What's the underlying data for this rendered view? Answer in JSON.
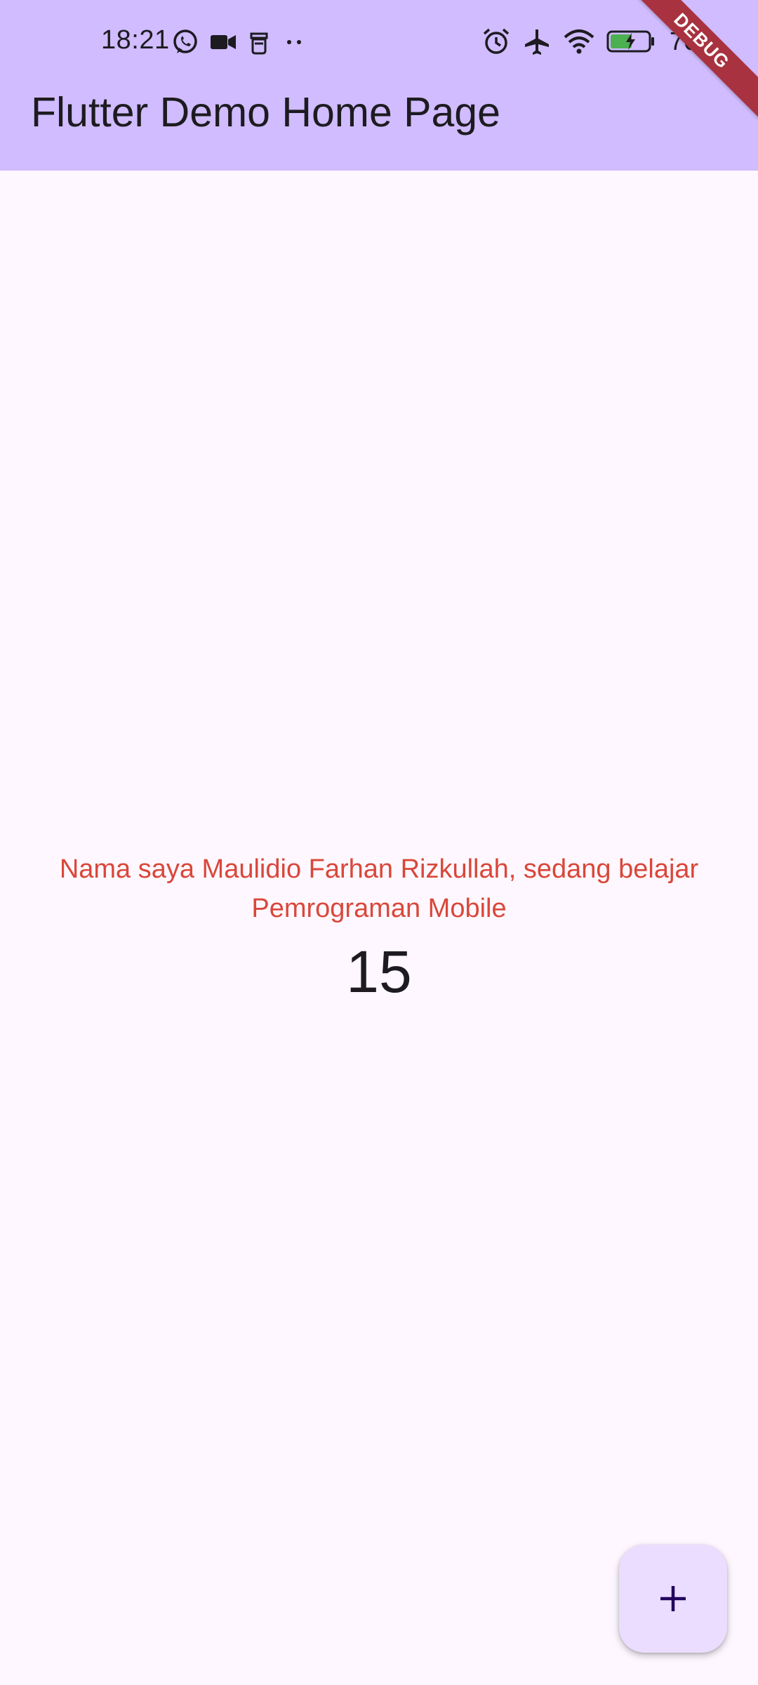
{
  "status_bar": {
    "time": "18:21",
    "battery_percent": "76",
    "left_icons": [
      "whatsapp-icon",
      "video-camera-icon",
      "notification-app-icon",
      "more-dots-icon"
    ],
    "right_icons": [
      "alarm-icon",
      "airplane-icon",
      "wifi-icon",
      "battery-charging-icon"
    ]
  },
  "app_bar": {
    "title": "Flutter Demo Home Page",
    "background_color": "#D0BCFF"
  },
  "debug_banner": {
    "label": "DEBUG",
    "color": "#A8323F"
  },
  "body": {
    "message": "Nama saya Maulidio Farhan Rizkullah, sedang belajar Pemrograman Mobile",
    "message_color": "#D9473A",
    "counter": "15",
    "background_color": "#FEF7FF"
  },
  "fab": {
    "icon": "add-icon",
    "color": "#EADDFF"
  }
}
